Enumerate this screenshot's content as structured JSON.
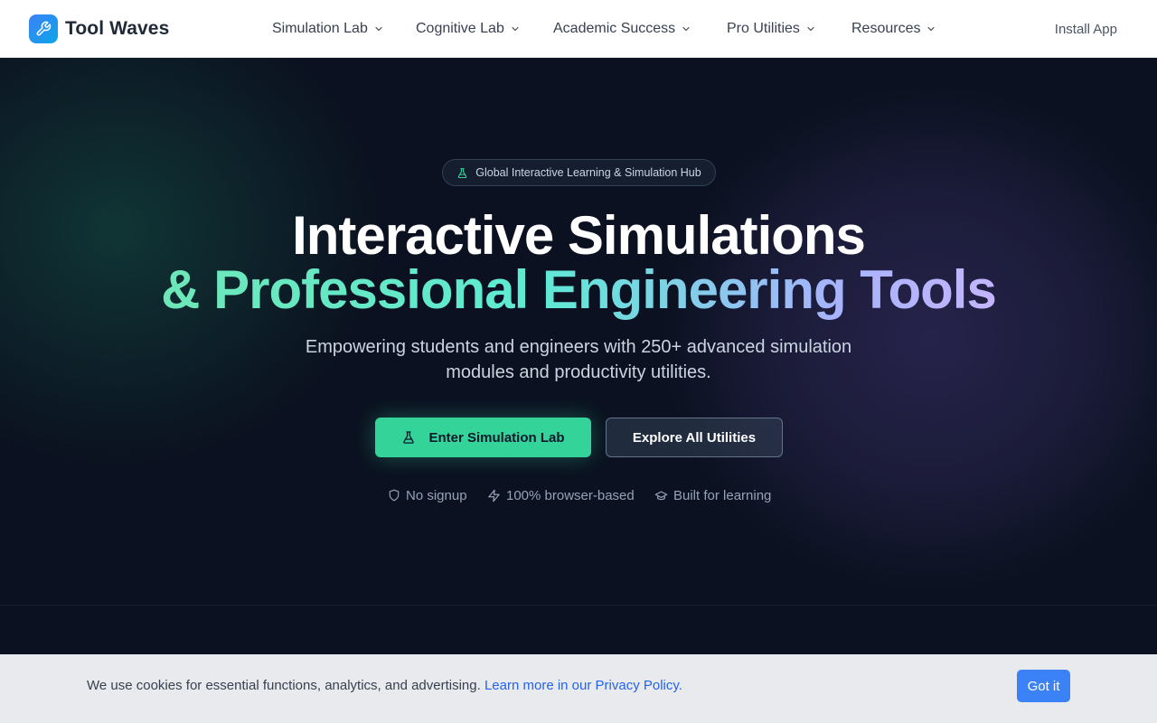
{
  "header": {
    "brand": "Tool Waves",
    "nav": [
      {
        "label": "Simulation Lab"
      },
      {
        "label": "Cognitive Lab"
      },
      {
        "label": "Academic Success"
      },
      {
        "label": "Pro Utilities"
      },
      {
        "label": "Resources"
      }
    ],
    "install_label": "Install App"
  },
  "hero": {
    "badge": "Global Interactive Learning & Simulation Hub",
    "title_line1": "Interactive Simulations",
    "title_line2": "& Professional Engineering Tools",
    "subtitle_line1": "Empowering students and engineers with 250+ advanced simulation",
    "subtitle_line2": "modules and productivity utilities.",
    "primary_button": "Enter Simulation Lab",
    "secondary_button": "Explore All Utilities",
    "features": [
      {
        "icon": "shield-icon",
        "label": "No signup"
      },
      {
        "icon": "lightning-icon",
        "label": "100% browser-based"
      },
      {
        "icon": "graduation-cap-icon",
        "label": "Built for learning"
      }
    ]
  },
  "cookie": {
    "text": "We use cookies for essential functions, analytics, and advertising.",
    "link": "Learn more in our Privacy Policy.",
    "button": "Got it"
  },
  "colors": {
    "accent_green": "#34d399",
    "link_blue": "#2563eb",
    "button_blue": "#3b82f6",
    "hero_background": "#0b1120"
  }
}
